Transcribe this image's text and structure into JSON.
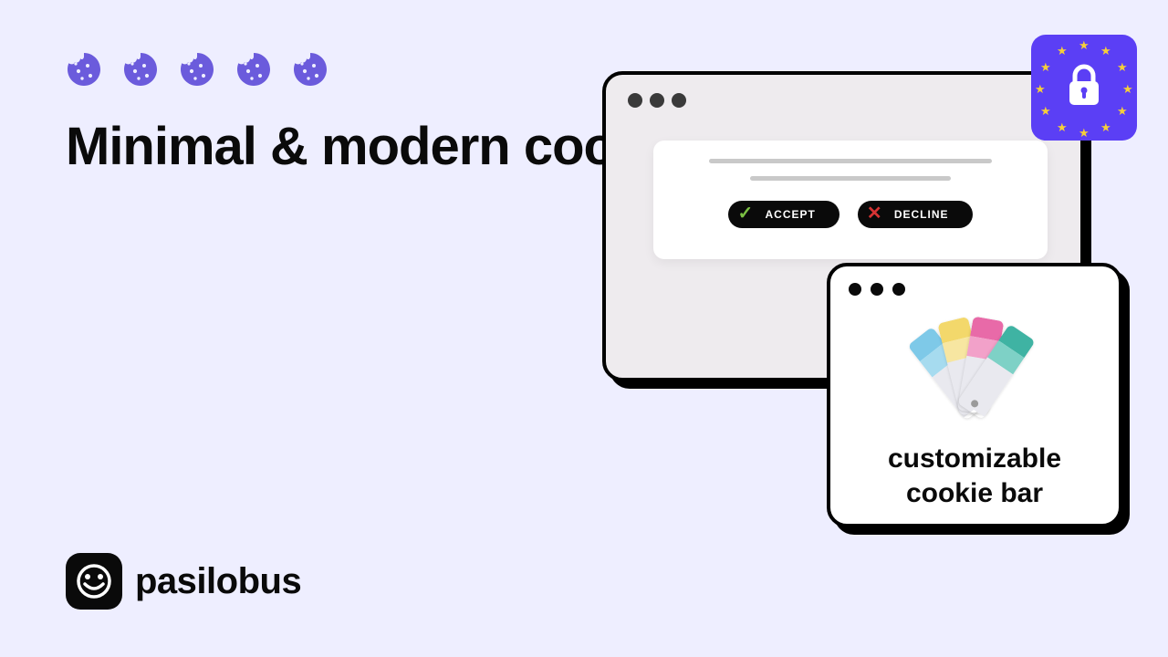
{
  "headline": "Minimal & modern\ncookie banner tool",
  "brand": {
    "name": "pasilobus"
  },
  "browser": {
    "banner": {
      "accept_label": "ACCEPT",
      "decline_label": "DECLINE"
    }
  },
  "custom_card": {
    "text": "customizable\ncookie bar"
  },
  "colors": {
    "accent": "#5b3ff5",
    "bg": "#eeeeff"
  }
}
